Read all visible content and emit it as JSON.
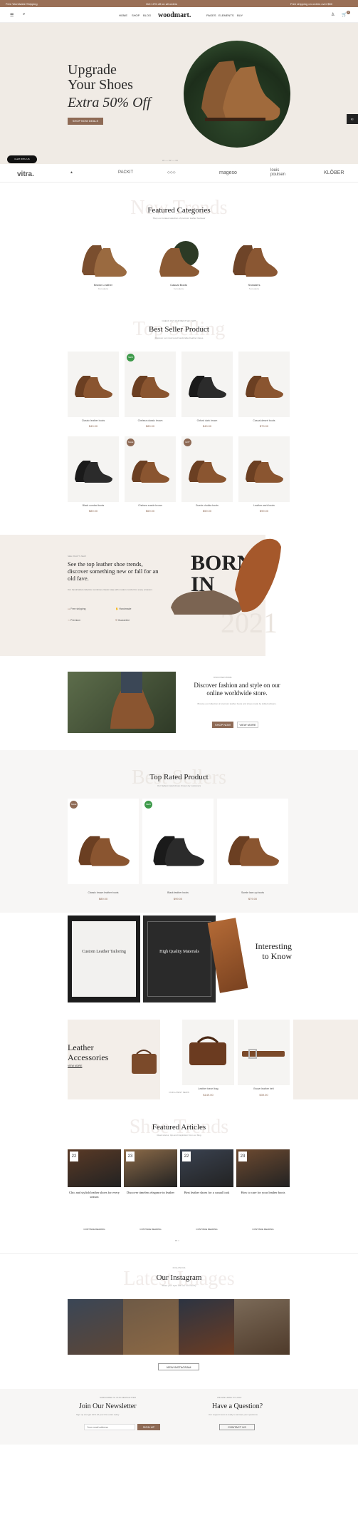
{
  "topbar": {
    "left": "Free Worldwide Shipping",
    "center": "Get 10% off on all orders",
    "right": "Free shipping on orders over $50"
  },
  "header": {
    "logo": "woodmart.",
    "nav_left": [
      "HOME",
      "SHOP",
      "BLOG"
    ],
    "nav_right": [
      "PAGES",
      "ELEMENTS",
      "BUY"
    ],
    "cart_count": "0"
  },
  "hero": {
    "title_line1": "Upgrade",
    "title_line2": "Your Shoes",
    "subtitle": "Extra 50% Off",
    "button": "SHOP NOW DEALS",
    "chat_label": "CHAT WITH US"
  },
  "brands": [
    "vitra.",
    "",
    "PACKIT",
    "",
    "mageso",
    "louis poulsen",
    "KLÖBER"
  ],
  "categories_section": {
    "ghost": "New Trends",
    "title": "Featured Categories",
    "items": [
      {
        "name": "Brown Leather",
        "count": "8 products"
      },
      {
        "name": "Casual Boots",
        "count": "6 products"
      },
      {
        "name": "Sneakers",
        "count": "5 products"
      }
    ]
  },
  "bestseller": {
    "ghost": "Top Selling",
    "title": "Best Seller Product",
    "products": [
      {
        "name": "Classic leather boots",
        "price": "$49.00",
        "badge": ""
      },
      {
        "name": "Chelsea classic brown",
        "price": "$89.00",
        "badge": "NEW"
      },
      {
        "name": "Oxford dark brown",
        "price": "$49.00",
        "badge": ""
      },
      {
        "name": "Casual desert boots",
        "price": "$79.00",
        "badge": ""
      },
      {
        "name": "Black combat boots",
        "price": "$89.00",
        "badge": ""
      },
      {
        "name": "Chelsea suede brown",
        "price": "$69.00",
        "badge": "SALE"
      },
      {
        "name": "Suede chukka boots",
        "price": "$59.00",
        "badge": "HOT"
      },
      {
        "name": "Leather work boots",
        "price": "$99.00",
        "badge": ""
      }
    ]
  },
  "born": {
    "kicker": "SEE WHAT'S NEW",
    "heading": "See the top leather shoe trends, discover something new or fall for an old fave.",
    "big1": "BORN",
    "big2": "IN",
    "big3": "2021",
    "features": [
      "Free shipping",
      "Handmade",
      "Premium",
      "Guarantee"
    ]
  },
  "discover": {
    "kicker": "DISCOVER MORE",
    "heading": "Discover fashion and style on our online worldwide store.",
    "btn1": "SHOP NOW",
    "btn2": "VIEW MORE"
  },
  "toprated": {
    "ghost": "Best Sellers",
    "title": "Top Rated Product",
    "products": [
      {
        "name": "Classic brown leather boots",
        "price": "$89.00",
        "badge": "SALE"
      },
      {
        "name": "Black leather boots",
        "price": "$99.00",
        "badge": "NEW"
      },
      {
        "name": "Suede lace-up boots",
        "price": "$79.00",
        "badge": ""
      }
    ]
  },
  "interesting": {
    "card1": "Custom Leather Tailoring",
    "card2": "High Quality Materials",
    "heading1": "Interesting",
    "heading2": "to Know"
  },
  "accessories": {
    "title1": "Leather",
    "title2": "Accessories",
    "link": "VIEW MORE",
    "items": [
      {
        "name": "Leather travel bag",
        "price": "$149.00"
      },
      {
        "name": "Brown leather belt",
        "price": "$39.00"
      }
    ]
  },
  "articles": {
    "ghost": "Shoe Trends",
    "title": "Featured Articles",
    "items": [
      {
        "day": "22",
        "title": "Chic and stylish leather shoes for every season"
      },
      {
        "day": "23",
        "title": "Discover timeless elegance in leather"
      },
      {
        "day": "22",
        "title": "Best leather shoes for a casual look"
      },
      {
        "day": "23",
        "title": "How to care for your leather boots"
      }
    ],
    "read_more": "CONTINUE READING"
  },
  "instagram": {
    "ghost": "Latest Images",
    "title": "Our Instagram",
    "button": "VIEW INSTAGRAM"
  },
  "newsletter": {
    "title": "Join Our Newsletter",
    "placeholder": "Your email address",
    "button": "SIGN UP"
  },
  "question": {
    "title": "Have a Question?",
    "button": "CONTACT US"
  },
  "colors": {
    "accent": "#8e6a55",
    "hero_bg": "#f0ebe5"
  }
}
